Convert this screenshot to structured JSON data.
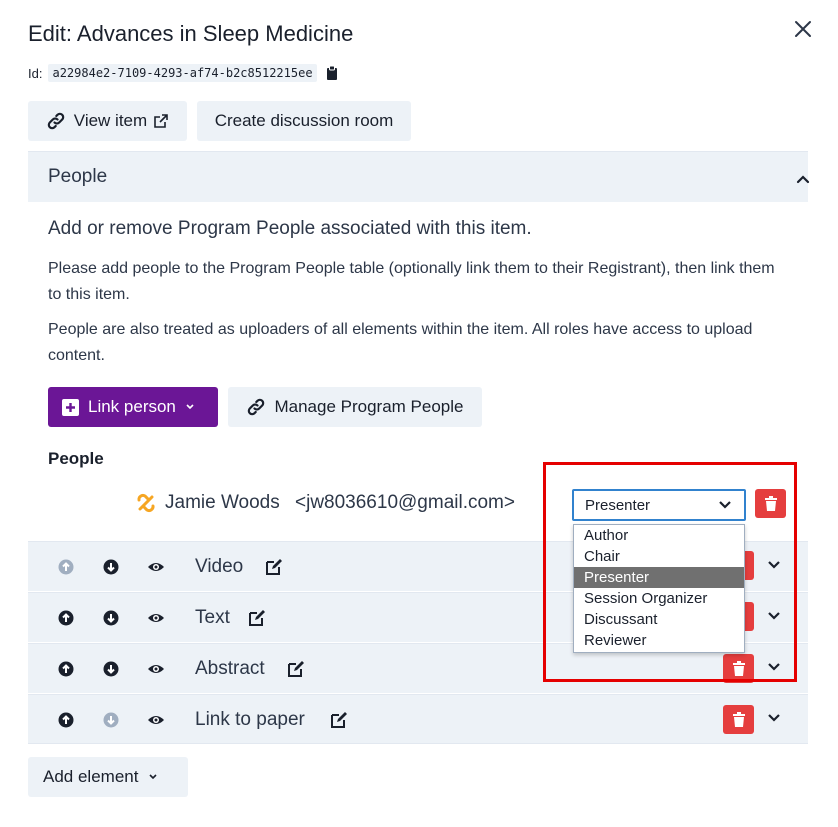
{
  "modal": {
    "title": "Edit: Advances in Sleep Medicine",
    "id_label": "Id:",
    "id_value": "a22984e2-7109-4293-af74-b2c8512215ee"
  },
  "actions": {
    "view_item": "View item",
    "create_room": "Create discussion room"
  },
  "people_section": {
    "header": "People",
    "intro": "Add or remove Program People associated with this item.",
    "help1": "Please add people to the Program People table (optionally link them to their Registrant), then link them to this item.",
    "help2": "People are also treated as uploaders of all elements within the item. All roles have access to upload content.",
    "link_person": "Link person",
    "manage_people": "Manage Program People",
    "list_heading": "People",
    "person": {
      "name": "Jamie Woods",
      "email": "<jw8036610@gmail.com>",
      "role": "Presenter"
    },
    "role_options": [
      "Author",
      "Chair",
      "Presenter",
      "Session Organizer",
      "Discussant",
      "Reviewer"
    ],
    "selected_option": "Presenter"
  },
  "elements": [
    {
      "label": "Video"
    },
    {
      "label": "Text"
    },
    {
      "label": "Abstract"
    },
    {
      "label": "Link to paper"
    }
  ],
  "add_element": "Add element",
  "colors": {
    "primary": "#6b1696",
    "danger": "#e53e3e",
    "highlight": "#e50000",
    "focus": "#3182ce"
  }
}
